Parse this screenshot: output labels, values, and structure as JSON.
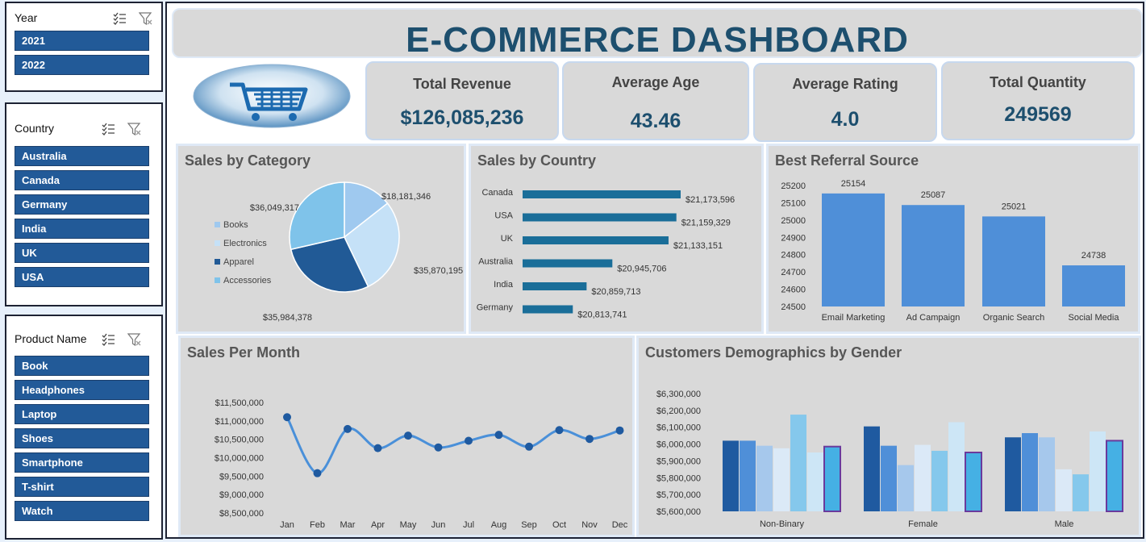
{
  "slicers": {
    "year": {
      "title": "Year",
      "items": [
        "2021",
        "2022"
      ]
    },
    "country": {
      "title": "Country",
      "items": [
        "Australia",
        "Canada",
        "Germany",
        "India",
        "UK",
        "USA"
      ]
    },
    "product": {
      "title": "Product Name",
      "items": [
        "Book",
        "Headphones",
        "Laptop",
        "Shoes",
        "Smartphone",
        "T-shirt",
        "Watch"
      ]
    }
  },
  "dashboard": {
    "title": "E-COMMERCE DASHBOARD",
    "logo_icon": "shopping-cart-icon",
    "kpis": [
      {
        "label": "Total Revenue",
        "value": "$126,085,236"
      },
      {
        "label": "Average Age",
        "value": "43.46"
      },
      {
        "label": "Average Rating",
        "value": "4.0"
      },
      {
        "label": "Total Quantity",
        "value": "249569"
      }
    ]
  },
  "colors": {
    "slicer_item": "#225a98",
    "title": "#1d4f6e",
    "panel": "#d9d9d9",
    "bar_country": "#1a6e99",
    "bar_referral": "#4f8fd8",
    "line": "#4a90d9"
  },
  "chart_data": [
    {
      "id": "category",
      "type": "pie",
      "title": "Sales by Category",
      "categories": [
        "Books",
        "Electronics",
        "Apparel",
        "Accessories"
      ],
      "values": [
        18181346,
        35870195,
        35984378,
        36049317
      ],
      "labels": [
        "$18,181,346",
        "$35,870,195",
        "$35,984,378",
        "$36,049,317"
      ],
      "colors": [
        "#9fc9ef",
        "#c5e1f7",
        "#215a96",
        "#7fc3ea"
      ],
      "legend": "left"
    },
    {
      "id": "country",
      "type": "bar",
      "orientation": "horizontal",
      "title": "Sales by Country",
      "categories": [
        "Canada",
        "USA",
        "UK",
        "Australia",
        "India",
        "Germany"
      ],
      "values": [
        21173596,
        21159329,
        21133151,
        20945706,
        20859713,
        20813741
      ],
      "labels": [
        "$21,173,596",
        "$21,159,329",
        "$21,133,151",
        "$20,945,706",
        "$20,859,713",
        "$20,813,741"
      ]
    },
    {
      "id": "referral",
      "type": "bar",
      "title": "Best Referral Source",
      "categories": [
        "Email Marketing",
        "Ad Campaign",
        "Organic Search",
        "Social Media"
      ],
      "values": [
        25154,
        25087,
        25021,
        24738
      ],
      "ylim": [
        24500,
        25200
      ],
      "yticks": [
        "25200",
        "25100",
        "25000",
        "24900",
        "24800",
        "24700",
        "24600",
        "24500"
      ],
      "grid": false
    },
    {
      "id": "month",
      "type": "line",
      "title": "Sales Per Month",
      "categories": [
        "Jan",
        "Feb",
        "Mar",
        "Apr",
        "May",
        "Jun",
        "Jul",
        "Aug",
        "Sep",
        "Oct",
        "Nov",
        "Dec"
      ],
      "values": [
        11100000,
        9580000,
        10780000,
        10260000,
        10600000,
        10280000,
        10460000,
        10620000,
        10300000,
        10750000,
        10510000,
        10740000
      ],
      "ylim": [
        8500000,
        11500000
      ],
      "yticks": [
        "$11,500,000",
        "$11,000,000",
        "$10,500,000",
        "$10,000,000",
        "$9,500,000",
        "$9,000,000",
        "$8,500,000"
      ]
    },
    {
      "id": "gender",
      "type": "bar",
      "title": "Customers Demographics by Gender",
      "categories": [
        "Non-Binary",
        "Female",
        "Male"
      ],
      "series": [
        {
          "color": "#1f5aa0",
          "values": [
            6020000,
            6105000,
            6040000
          ]
        },
        {
          "color": "#4f8fd8",
          "values": [
            6020000,
            5990000,
            6065000
          ]
        },
        {
          "color": "#a6c8ec",
          "values": [
            5990000,
            5875000,
            6040000
          ]
        },
        {
          "color": "#dbe9f7",
          "values": [
            5975000,
            5995000,
            5850000
          ]
        },
        {
          "color": "#85c8ec",
          "values": [
            6175000,
            5960000,
            5820000
          ]
        },
        {
          "color": "#cde6f6",
          "values": [
            5950000,
            6130000,
            6075000
          ]
        },
        {
          "color": "#45b0e4",
          "outline": "#6a3a9c",
          "values": [
            5985000,
            5950000,
            6020000
          ]
        }
      ],
      "ylim": [
        5600000,
        6300000
      ],
      "yticks": [
        "$6,300,000",
        "$6,200,000",
        "$6,100,000",
        "$6,000,000",
        "$5,900,000",
        "$5,800,000",
        "$5,700,000",
        "$5,600,000"
      ]
    }
  ]
}
